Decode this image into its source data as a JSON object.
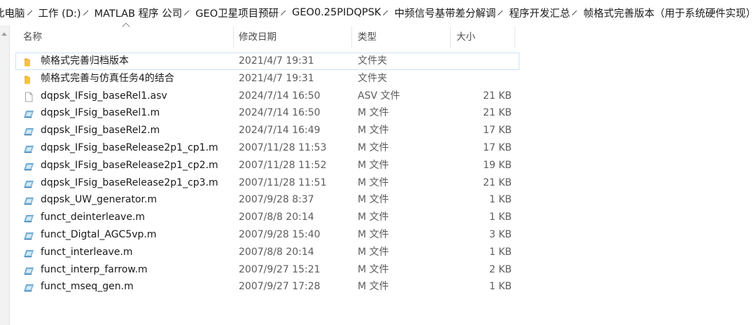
{
  "breadcrumb": [
    "此电脑",
    "工作 (D:)",
    "MATLAB 程序 公司",
    "GEO卫星项目预研",
    "GEO0.25PIDQPSK",
    "中频信号基带差分解调",
    "程序开发汇总",
    "帧格式完善版本（用于系统硬件实现）"
  ],
  "columns": {
    "name": "名称",
    "date": "修改日期",
    "type": "类型",
    "size": "大小"
  },
  "files": [
    {
      "name": "帧格式完善归档版本",
      "date": "2021/4/7 19:31",
      "type": "文件夹",
      "size": "",
      "icon": "folder-icon"
    },
    {
      "name": "帧格式完善与仿真任务4的结合",
      "date": "2021/4/7 19:31",
      "type": "文件夹",
      "size": "",
      "icon": "folder-icon"
    },
    {
      "name": "dqpsk_IFsig_baseRel1.asv",
      "date": "2024/7/14 16:50",
      "type": "ASV 文件",
      "size": "21 KB",
      "icon": "document-icon"
    },
    {
      "name": "dqpsk_IFsig_baseRel1.m",
      "date": "2024/7/14 16:50",
      "type": "M 文件",
      "size": "21 KB",
      "icon": "matlab-file-icon"
    },
    {
      "name": "dqpsk_IFsig_baseRel2.m",
      "date": "2024/7/14 16:49",
      "type": "M 文件",
      "size": "17 KB",
      "icon": "matlab-file-icon"
    },
    {
      "name": "dqpsk_IFsig_baseRelease2p1_cp1.m",
      "date": "2007/11/28 11:53",
      "type": "M 文件",
      "size": "17 KB",
      "icon": "matlab-file-icon"
    },
    {
      "name": "dqpsk_IFsig_baseRelease2p1_cp2.m",
      "date": "2007/11/28 11:52",
      "type": "M 文件",
      "size": "19 KB",
      "icon": "matlab-file-icon"
    },
    {
      "name": "dqpsk_IFsig_baseRelease2p1_cp3.m",
      "date": "2007/11/28 11:51",
      "type": "M 文件",
      "size": "21 KB",
      "icon": "matlab-file-icon"
    },
    {
      "name": "dqpsk_UW_generator.m",
      "date": "2007/9/28 8:37",
      "type": "M 文件",
      "size": "1 KB",
      "icon": "matlab-file-icon"
    },
    {
      "name": "funct_deinterleave.m",
      "date": "2007/8/8 20:14",
      "type": "M 文件",
      "size": "1 KB",
      "icon": "matlab-file-icon"
    },
    {
      "name": "funct_Digtal_AGC5vp.m",
      "date": "2007/9/28 15:40",
      "type": "M 文件",
      "size": "3 KB",
      "icon": "matlab-file-icon"
    },
    {
      "name": "funct_interleave.m",
      "date": "2007/8/8 20:14",
      "type": "M 文件",
      "size": "1 KB",
      "icon": "matlab-file-icon"
    },
    {
      "name": "funct_interp_farrow.m",
      "date": "2007/9/27 15:21",
      "type": "M 文件",
      "size": "2 KB",
      "icon": "matlab-file-icon"
    },
    {
      "name": "funct_mseq_gen.m",
      "date": "2007/9/27 17:28",
      "type": "M 文件",
      "size": "1 KB",
      "icon": "matlab-file-icon"
    }
  ],
  "colors": {
    "folder": "#f5c242",
    "matlab_icon": "#5b9bc8",
    "selection_outline": "#cce4f7"
  }
}
